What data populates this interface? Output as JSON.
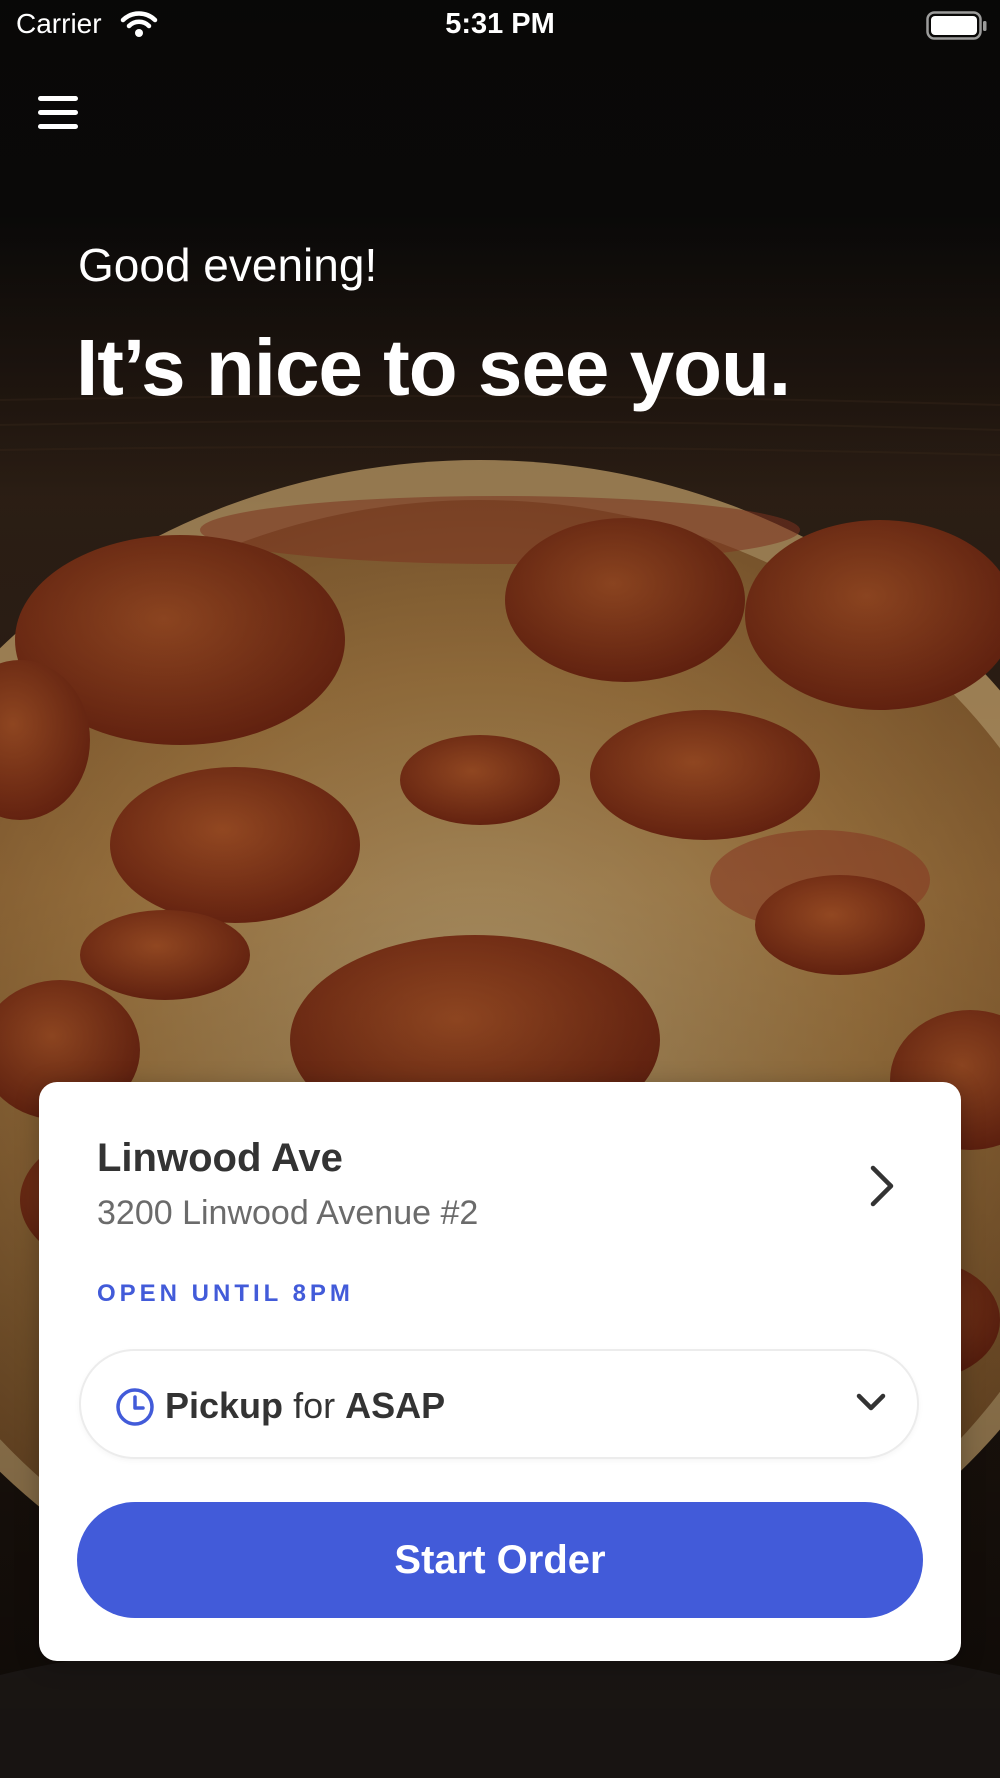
{
  "status_bar": {
    "carrier": "Carrier",
    "time": "5:31 PM",
    "icons": [
      "wifi-icon",
      "battery-icon"
    ]
  },
  "header": {
    "menu_icon": "hamburger-menu-icon",
    "greeting": "Good evening!",
    "headline": "It’s nice to see you."
  },
  "background_image": "pepperoni pizza on wooden table",
  "location_card": {
    "name": "Linwood Ave",
    "address": "3200 Linwood Avenue #2",
    "hours": "OPEN UNTIL 8PM",
    "chevron_icon": "chevron-right-icon"
  },
  "order_mode": {
    "icon": "clock-icon",
    "mode": "Pickup",
    "connector": "for",
    "time": "ASAP",
    "dropdown_icon": "chevron-down-icon"
  },
  "start_button": {
    "label": "Start Order"
  },
  "colors": {
    "accent": "#425bd9",
    "text_dark": "#333333",
    "text_muted": "#6b6b6b",
    "card_bg": "#ffffff"
  }
}
